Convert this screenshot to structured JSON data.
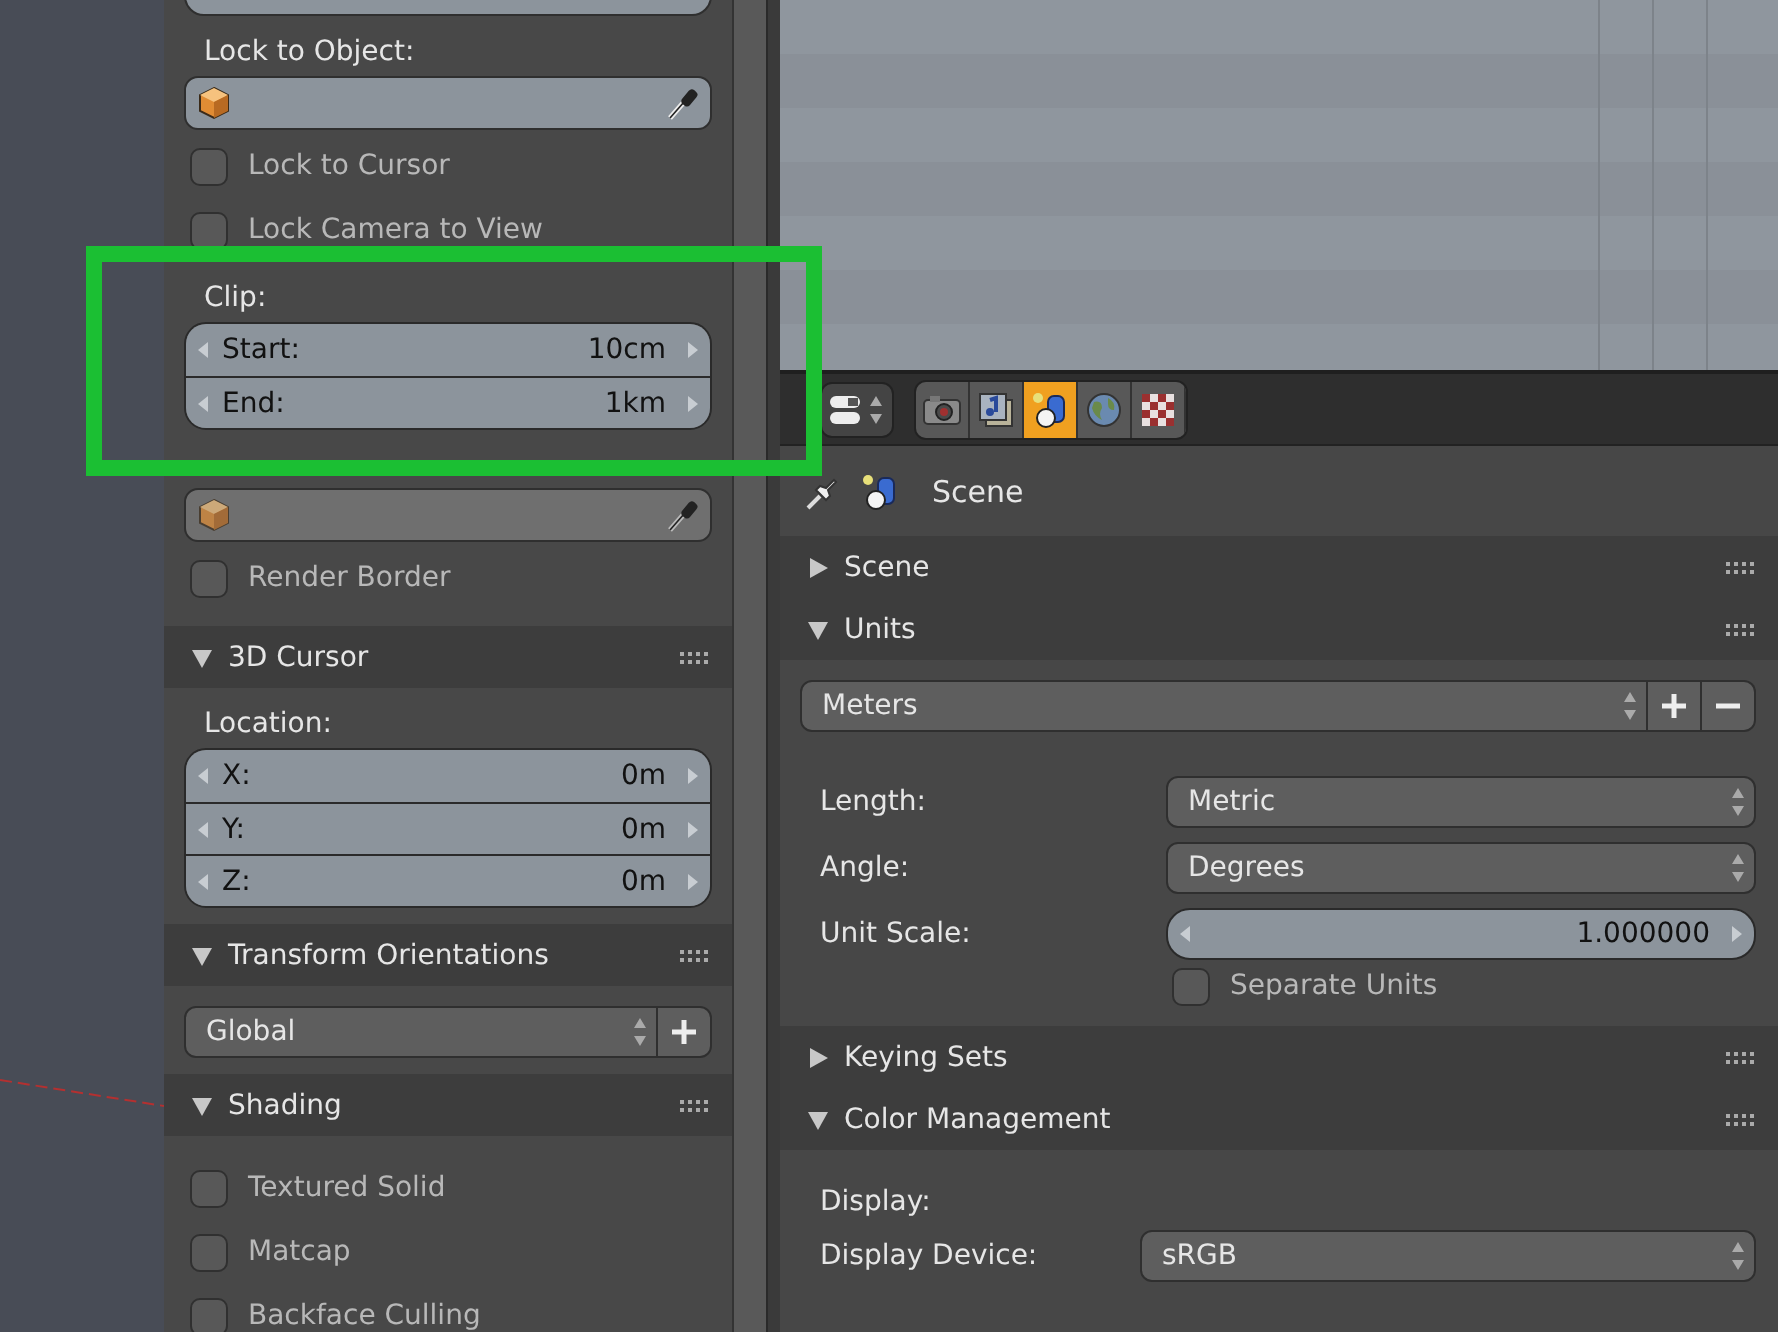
{
  "sidebar": {
    "panels": [
      {
        "items": [
          {
            "kind": "cut_field"
          },
          {
            "kind": "label",
            "text": "Lock to Object:"
          },
          {
            "kind": "object_field",
            "disabled": false
          },
          {
            "kind": "checkbox",
            "label": "Lock to Cursor",
            "checked": false
          },
          {
            "kind": "checkbox",
            "label": "Lock Camera to View",
            "checked": false
          },
          {
            "kind": "label",
            "text": "Clip:"
          },
          {
            "kind": "number_group",
            "fields": [
              {
                "label": "Start:",
                "value": "10cm"
              },
              {
                "label": "End:",
                "value": "1km"
              }
            ]
          },
          {
            "kind": "object_field",
            "disabled": true
          },
          {
            "kind": "checkbox",
            "label": "Render Border",
            "checked": false
          }
        ]
      },
      {
        "title": "3D Cursor",
        "expanded": true,
        "items": [
          {
            "kind": "label",
            "text": "Location:"
          },
          {
            "kind": "number_group",
            "fields": [
              {
                "label": "X:",
                "value": "0m"
              },
              {
                "label": "Y:",
                "value": "0m"
              },
              {
                "label": "Z:",
                "value": "0m"
              }
            ]
          }
        ]
      },
      {
        "title": "Transform Orientations",
        "expanded": true,
        "items": [
          {
            "kind": "dropdown",
            "value": "Global"
          }
        ]
      },
      {
        "title": "Shading",
        "expanded": true,
        "items": [
          {
            "kind": "checkbox",
            "label": "Textured Solid",
            "checked": false
          },
          {
            "kind": "checkbox",
            "label": "Matcap",
            "checked": false
          },
          {
            "kind": "checkbox",
            "label": "Backface Culling",
            "checked": false
          }
        ]
      }
    ]
  },
  "properties": {
    "tabs": [
      {
        "kind": "render",
        "selected": false
      },
      {
        "kind": "layers",
        "selected": false
      },
      {
        "kind": "scene",
        "selected": true
      },
      {
        "kind": "world",
        "selected": false
      },
      {
        "kind": "texture",
        "selected": false
      }
    ],
    "context": "Scene",
    "panels": [
      {
        "title": "Scene",
        "expanded": false
      },
      {
        "title": "Units",
        "expanded": true,
        "items": [
          {
            "kind": "preset",
            "value": "Meters"
          },
          {
            "kind": "select",
            "label": "Length:",
            "value": "Metric"
          },
          {
            "kind": "select",
            "label": "Angle:",
            "value": "Degrees"
          },
          {
            "kind": "number",
            "label": "Unit Scale:",
            "value": "1.000000"
          },
          {
            "kind": "checkbox",
            "label": "Separate Units",
            "checked": false
          }
        ]
      },
      {
        "title": "Keying Sets",
        "expanded": false
      },
      {
        "title": "Color Management",
        "expanded": true,
        "items": [
          {
            "kind": "label",
            "text": "Display:"
          },
          {
            "kind": "select",
            "label": "Display Device:",
            "value": "sRGB"
          }
        ]
      }
    ]
  }
}
